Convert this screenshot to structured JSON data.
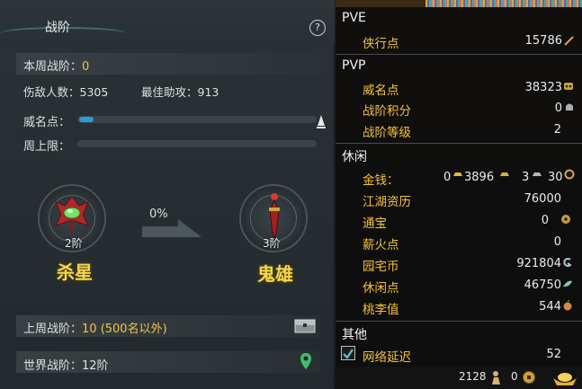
{
  "left": {
    "title": "战阶",
    "help": "?",
    "weekly_rank_label": "本周战阶：",
    "weekly_rank_value": "0",
    "kills_label": "伤敌人数：",
    "kills_value": "5305",
    "assist_label": "最佳助攻：",
    "assist_value": "913",
    "fame_label": "威名点：",
    "fame_progress": 0.06,
    "weekly_cap_label": "周上限：",
    "weekly_cap_progress": 0,
    "current_tier": "2阶",
    "current_rank": "杀星",
    "progress_text": "0%",
    "next_tier": "3阶",
    "next_rank": "鬼雄",
    "last_week_label": "上周战阶：",
    "last_week_value": "10 (500名以外)",
    "world_rank_label": "世界战阶：",
    "world_rank_value": "12阶"
  },
  "right": {
    "pve": {
      "title": "PVE",
      "items": [
        {
          "label": "侠行点",
          "value": "15786"
        }
      ]
    },
    "pvp": {
      "title": "PVP",
      "items": [
        {
          "label": "威名点",
          "value": "38323"
        },
        {
          "label": "战阶积分",
          "value": "0"
        },
        {
          "label": "战阶等级",
          "value": "2"
        }
      ]
    },
    "leisure": {
      "title": "休闲",
      "money_label": "金钱：",
      "money_gold": "0",
      "money_silver": "3896",
      "money_copper": "3",
      "money_coin": "30",
      "items": [
        {
          "label": "江湖资历",
          "value": "76000"
        },
        {
          "label": "通宝",
          "value": "0"
        },
        {
          "label": "薪火点",
          "value": "0"
        },
        {
          "label": "园宅币",
          "value": "921804"
        },
        {
          "label": "休闲点",
          "value": "46750"
        },
        {
          "label": "桃李值",
          "value": "544"
        }
      ]
    },
    "other": {
      "title": "其他",
      "latency_label": "网络延迟",
      "latency_value": "52"
    },
    "bottom": {
      "count_a": "2128",
      "count_b": "0"
    }
  },
  "colors": {
    "accent_yellow": "#f0c34a",
    "fame_bar": "#2d9ad8",
    "panel_bg": "#0e0e0e"
  }
}
